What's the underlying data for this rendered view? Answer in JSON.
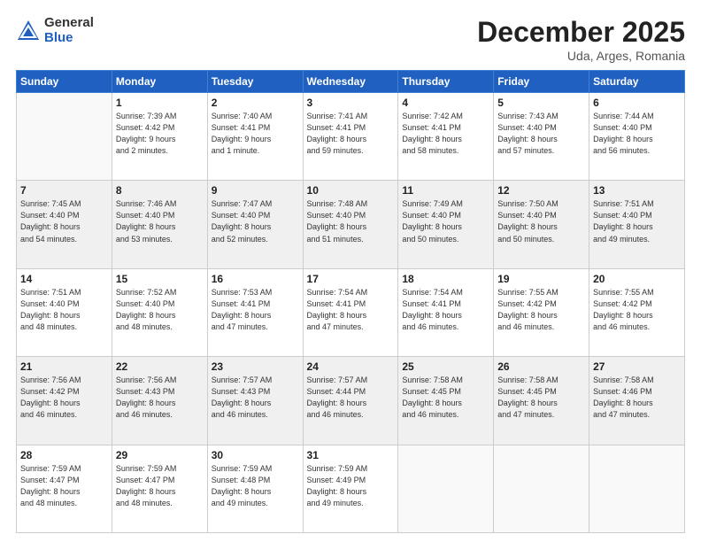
{
  "header": {
    "logo_general": "General",
    "logo_blue": "Blue",
    "month_title": "December 2025",
    "location": "Uda, Arges, Romania"
  },
  "weekdays": [
    "Sunday",
    "Monday",
    "Tuesday",
    "Wednesday",
    "Thursday",
    "Friday",
    "Saturday"
  ],
  "rows": [
    [
      {
        "day": "",
        "info": ""
      },
      {
        "day": "1",
        "info": "Sunrise: 7:39 AM\nSunset: 4:42 PM\nDaylight: 9 hours\nand 2 minutes."
      },
      {
        "day": "2",
        "info": "Sunrise: 7:40 AM\nSunset: 4:41 PM\nDaylight: 9 hours\nand 1 minute."
      },
      {
        "day": "3",
        "info": "Sunrise: 7:41 AM\nSunset: 4:41 PM\nDaylight: 8 hours\nand 59 minutes."
      },
      {
        "day": "4",
        "info": "Sunrise: 7:42 AM\nSunset: 4:41 PM\nDaylight: 8 hours\nand 58 minutes."
      },
      {
        "day": "5",
        "info": "Sunrise: 7:43 AM\nSunset: 4:40 PM\nDaylight: 8 hours\nand 57 minutes."
      },
      {
        "day": "6",
        "info": "Sunrise: 7:44 AM\nSunset: 4:40 PM\nDaylight: 8 hours\nand 56 minutes."
      }
    ],
    [
      {
        "day": "7",
        "info": "Sunrise: 7:45 AM\nSunset: 4:40 PM\nDaylight: 8 hours\nand 54 minutes."
      },
      {
        "day": "8",
        "info": "Sunrise: 7:46 AM\nSunset: 4:40 PM\nDaylight: 8 hours\nand 53 minutes."
      },
      {
        "day": "9",
        "info": "Sunrise: 7:47 AM\nSunset: 4:40 PM\nDaylight: 8 hours\nand 52 minutes."
      },
      {
        "day": "10",
        "info": "Sunrise: 7:48 AM\nSunset: 4:40 PM\nDaylight: 8 hours\nand 51 minutes."
      },
      {
        "day": "11",
        "info": "Sunrise: 7:49 AM\nSunset: 4:40 PM\nDaylight: 8 hours\nand 50 minutes."
      },
      {
        "day": "12",
        "info": "Sunrise: 7:50 AM\nSunset: 4:40 PM\nDaylight: 8 hours\nand 50 minutes."
      },
      {
        "day": "13",
        "info": "Sunrise: 7:51 AM\nSunset: 4:40 PM\nDaylight: 8 hours\nand 49 minutes."
      }
    ],
    [
      {
        "day": "14",
        "info": "Sunrise: 7:51 AM\nSunset: 4:40 PM\nDaylight: 8 hours\nand 48 minutes."
      },
      {
        "day": "15",
        "info": "Sunrise: 7:52 AM\nSunset: 4:40 PM\nDaylight: 8 hours\nand 48 minutes."
      },
      {
        "day": "16",
        "info": "Sunrise: 7:53 AM\nSunset: 4:41 PM\nDaylight: 8 hours\nand 47 minutes."
      },
      {
        "day": "17",
        "info": "Sunrise: 7:54 AM\nSunset: 4:41 PM\nDaylight: 8 hours\nand 47 minutes."
      },
      {
        "day": "18",
        "info": "Sunrise: 7:54 AM\nSunset: 4:41 PM\nDaylight: 8 hours\nand 46 minutes."
      },
      {
        "day": "19",
        "info": "Sunrise: 7:55 AM\nSunset: 4:42 PM\nDaylight: 8 hours\nand 46 minutes."
      },
      {
        "day": "20",
        "info": "Sunrise: 7:55 AM\nSunset: 4:42 PM\nDaylight: 8 hours\nand 46 minutes."
      }
    ],
    [
      {
        "day": "21",
        "info": "Sunrise: 7:56 AM\nSunset: 4:42 PM\nDaylight: 8 hours\nand 46 minutes."
      },
      {
        "day": "22",
        "info": "Sunrise: 7:56 AM\nSunset: 4:43 PM\nDaylight: 8 hours\nand 46 minutes."
      },
      {
        "day": "23",
        "info": "Sunrise: 7:57 AM\nSunset: 4:43 PM\nDaylight: 8 hours\nand 46 minutes."
      },
      {
        "day": "24",
        "info": "Sunrise: 7:57 AM\nSunset: 4:44 PM\nDaylight: 8 hours\nand 46 minutes."
      },
      {
        "day": "25",
        "info": "Sunrise: 7:58 AM\nSunset: 4:45 PM\nDaylight: 8 hours\nand 46 minutes."
      },
      {
        "day": "26",
        "info": "Sunrise: 7:58 AM\nSunset: 4:45 PM\nDaylight: 8 hours\nand 47 minutes."
      },
      {
        "day": "27",
        "info": "Sunrise: 7:58 AM\nSunset: 4:46 PM\nDaylight: 8 hours\nand 47 minutes."
      }
    ],
    [
      {
        "day": "28",
        "info": "Sunrise: 7:59 AM\nSunset: 4:47 PM\nDaylight: 8 hours\nand 48 minutes."
      },
      {
        "day": "29",
        "info": "Sunrise: 7:59 AM\nSunset: 4:47 PM\nDaylight: 8 hours\nand 48 minutes."
      },
      {
        "day": "30",
        "info": "Sunrise: 7:59 AM\nSunset: 4:48 PM\nDaylight: 8 hours\nand 49 minutes."
      },
      {
        "day": "31",
        "info": "Sunrise: 7:59 AM\nSunset: 4:49 PM\nDaylight: 8 hours\nand 49 minutes."
      },
      {
        "day": "",
        "info": ""
      },
      {
        "day": "",
        "info": ""
      },
      {
        "day": "",
        "info": ""
      }
    ]
  ]
}
